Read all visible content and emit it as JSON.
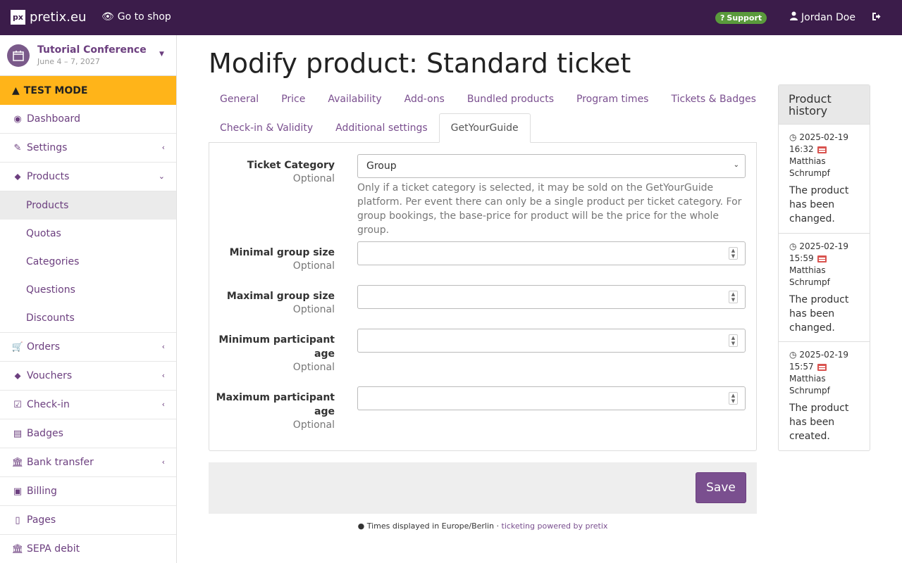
{
  "topbar": {
    "logo_mark": "px",
    "brand": "pretix.eu",
    "goto_shop": "Go to shop",
    "support": "Support",
    "user": "Jordan Doe"
  },
  "sidebar": {
    "event_name": "Tutorial Conference",
    "event_date": "June 4 – 7, 2027",
    "test_mode": "TEST MODE",
    "items": [
      {
        "label": "Dashboard",
        "icon": "dashboard-icon"
      },
      {
        "label": "Settings",
        "icon": "wrench-icon"
      },
      {
        "label": "Products",
        "icon": "tags-icon"
      },
      {
        "label": "Orders",
        "icon": "cart-icon"
      },
      {
        "label": "Vouchers",
        "icon": "tags-icon"
      },
      {
        "label": "Check-in",
        "icon": "check-square-icon"
      },
      {
        "label": "Badges",
        "icon": "id-card-icon"
      },
      {
        "label": "Bank transfer",
        "icon": "bank-icon"
      },
      {
        "label": "Billing",
        "icon": "money-icon"
      },
      {
        "label": "Pages",
        "icon": "file-icon"
      },
      {
        "label": "SEPA debit",
        "icon": "bank-icon"
      }
    ],
    "products_sub": [
      "Products",
      "Quotas",
      "Categories",
      "Questions",
      "Discounts"
    ]
  },
  "main": {
    "title": "Modify product: Standard ticket",
    "tabs_row1": [
      "General",
      "Price",
      "Availability",
      "Add-ons",
      "Bundled products",
      "Program times",
      "Tickets & Badges"
    ],
    "tabs_row2": [
      "Check-in & Validity",
      "Additional settings",
      "GetYourGuide"
    ],
    "active_tab": "GetYourGuide",
    "form": {
      "optional": "Optional",
      "ticket_category_label": "Ticket Category",
      "ticket_category_value": "Group",
      "ticket_category_help": "Only if a ticket category is selected, it may be sold on the GetYourGuide platform. Per event there can only be a single product per ticket category. For group bookings, the base-price for product will be the price for the whole group.",
      "min_group_label": "Minimal group size",
      "max_group_label": "Maximal group size",
      "min_age_label": "Minimum participant age",
      "max_age_label": "Maximum participant age"
    },
    "save": "Save",
    "footer_tz": "Times displayed in Europe/Berlin",
    "footer_sep": " · ",
    "footer_link": "ticketing powered by pretix"
  },
  "history": {
    "title": "Product history",
    "entries": [
      {
        "time": "2025-02-19 16:32",
        "user": "Matthias Schrumpf",
        "text": "The product has been changed."
      },
      {
        "time": "2025-02-19 15:59",
        "user": "Matthias Schrumpf",
        "text": "The product has been changed."
      },
      {
        "time": "2025-02-19 15:57",
        "user": "Matthias Schrumpf",
        "text": "The product has been created."
      }
    ]
  },
  "colors": {
    "topbar": "#3b1c4a",
    "accent": "#7a4f8f",
    "test_mode": "#ffb419",
    "support": "#5a9a3c"
  }
}
